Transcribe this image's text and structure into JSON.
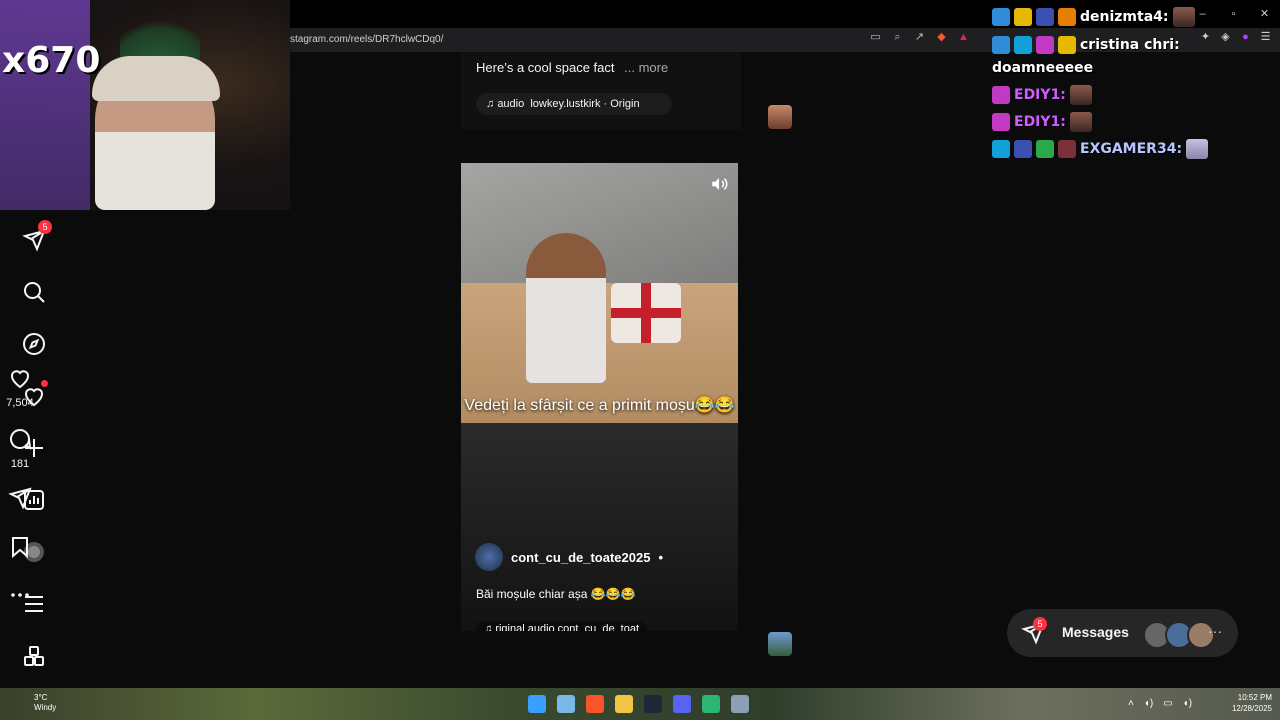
{
  "browser": {
    "url": "stagram.com/reels/DR7hclwCDq0/"
  },
  "webcam": {
    "counter": "x670"
  },
  "nav": {
    "notifications_badge": "5"
  },
  "feed": {
    "prev_post": {
      "caption": "Here’s a cool space fact",
      "more_label": "... more",
      "audio_label": "audio",
      "audio_text": "lowkey.lustkirk · Origin"
    },
    "reel": {
      "overlay_text": "Vedeți la sfârșit ce a primit moșu😂😂",
      "author": "cont_cu_de_toate2025",
      "author_sep": "•",
      "caption": "Băi moșule chiar așa 😂😂😂",
      "audio_text": "riginal audio  cont_cu_de_toat"
    },
    "actions": {
      "likes": "7,504",
      "comments": "181"
    }
  },
  "chat": {
    "lines": [
      {
        "name": "denizmta4:",
        "message": "",
        "color": "#ffffff"
      },
      {
        "name": "cristina chri:",
        "message": "",
        "color": "#ffffff"
      },
      {
        "name": "",
        "message": "doamneeeee",
        "color": "#ffffff"
      },
      {
        "name": "EDIY1:",
        "message": "",
        "color": "#d15cff"
      },
      {
        "name": "EDIY1:",
        "message": "",
        "color": "#d15cff"
      },
      {
        "name": "EXGAMER34:",
        "message": "",
        "color": "#b8c6ff"
      }
    ]
  },
  "messages": {
    "label": "Messages",
    "badge": "5"
  },
  "taskbar": {
    "weather_temp": "3°C",
    "weather_desc": "Windy",
    "time": "10:52 PM",
    "date": "12/28/2025"
  },
  "colors": {
    "accent_red": "#ff3040",
    "background": "#000000"
  }
}
